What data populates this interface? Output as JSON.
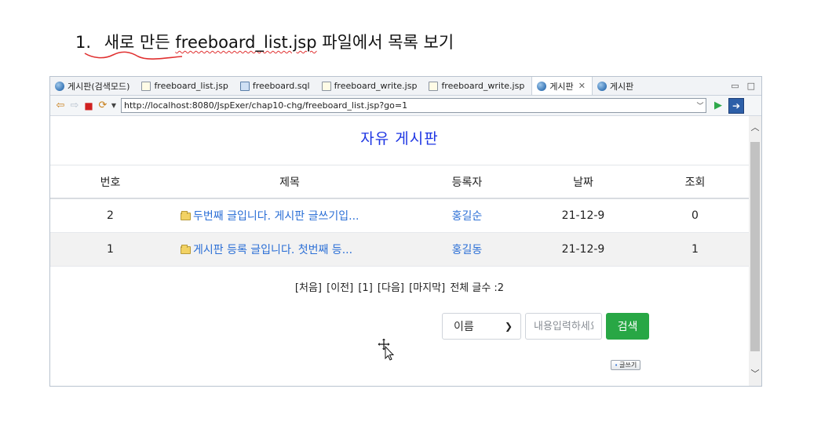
{
  "slide": {
    "number": "1.",
    "text_before": "새로 만든",
    "filename": "freeboard_list.jsp",
    "text_after": "파일에서 목록 보기"
  },
  "editor_tabs": [
    {
      "label": "게시판(검색모드)",
      "icon": "globe-icon"
    },
    {
      "label": "freeboard_list.jsp",
      "icon": "jsp-file-icon"
    },
    {
      "label": "freeboard.sql",
      "icon": "sql-file-icon"
    },
    {
      "label": "freeboard_write.jsp",
      "icon": "jsp-file-icon"
    },
    {
      "label": "freeboard_write.jsp",
      "icon": "jsp-file-icon"
    },
    {
      "label": "게시판",
      "icon": "globe-icon",
      "active": true,
      "close": "✕"
    },
    {
      "label": "게시판",
      "icon": "globe-icon"
    }
  ],
  "browser": {
    "url": "http://localhost:8080/JspExer/chap10-chg/freeboard_list.jsp?go=1"
  },
  "page": {
    "title": "자유 게시판",
    "columns": [
      "번호",
      "제목",
      "등록자",
      "날짜",
      "조회"
    ],
    "rows": [
      {
        "no": "2",
        "title": "두번째 글입니다. 게시판 글쓰기입...",
        "author": "홍길순",
        "date": "21-12-9",
        "views": "0"
      },
      {
        "no": "1",
        "title": "게시판 등록 글입니다. 첫번째 등...",
        "author": "홍길동",
        "date": "21-12-9",
        "views": "1"
      }
    ],
    "pager": {
      "first": "[처음]",
      "prev": "[이전]",
      "page1": "[1]",
      "next": "[다음]",
      "last": "[마지막]",
      "total": "전체 글수 :2"
    },
    "search": {
      "field_selected": "이름",
      "placeholder": "내용입력하세요",
      "button": "검색"
    },
    "write_button": "글쓰기"
  },
  "colors": {
    "title_blue": "#1d35e3",
    "link_blue": "#2b6fd6",
    "search_green": "#28a745",
    "underline_red": "#e03030"
  }
}
